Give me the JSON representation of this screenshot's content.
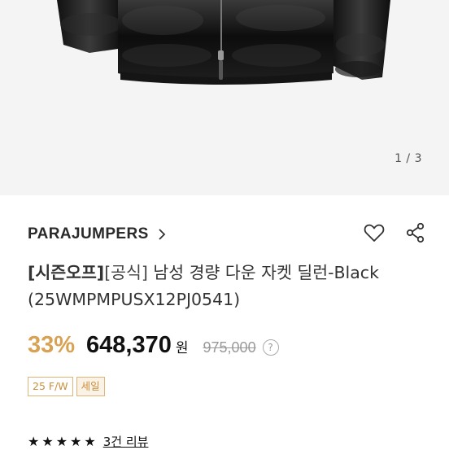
{
  "gallery": {
    "pager": "1 / 3"
  },
  "product": {
    "brand": "PARAJUMPERS",
    "title_tag_official_season": "[시즌오프]",
    "title_tag_official": "[공식]",
    "title_text": " 남성 경량 다운 자켓 딜런-Black",
    "title_code": "(25WMPMPUSX12PJ0541)",
    "discount": "33%",
    "price": "648,370",
    "currency": "원",
    "original_price": "975,000",
    "badges": [
      "25 F/W",
      "세일"
    ],
    "stars": "★★★★★",
    "reviews": "3건 리뷰"
  },
  "icons": {
    "brand_chevron": "chevron-right-icon",
    "wishlist": "heart-icon",
    "share": "share-icon",
    "help": "question-circle-icon"
  },
  "colors": {
    "accent": "#d9a253",
    "badge_border": "#e0b57a"
  }
}
